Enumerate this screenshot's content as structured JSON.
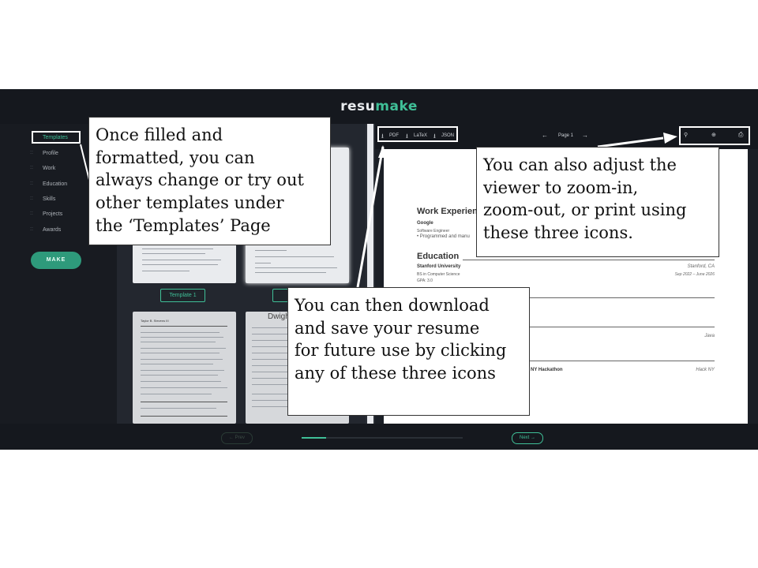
{
  "app": {
    "logo_a": "resu",
    "logo_b": "make"
  },
  "sidebar": {
    "items": [
      {
        "label": "Templates"
      },
      {
        "label": "Profile"
      },
      {
        "label": "Work"
      },
      {
        "label": "Education"
      },
      {
        "label": "Skills"
      },
      {
        "label": "Projects"
      },
      {
        "label": "Awards"
      }
    ],
    "make_label": "MAKE"
  },
  "gallery": {
    "template1_label": "Template 1",
    "template2_label": "Tem",
    "thumb3_heading": "Dwight",
    "thumb4_name": "Taylor B. Stevens III"
  },
  "viewer": {
    "pdf_label": "PDF",
    "latex_label": "LaTeX",
    "json_label": "JSON",
    "page_label": "Page 1",
    "prev_page_icon": "arrow-left-icon",
    "next_page_icon": "arrow-right-icon",
    "zoom_out_icon": "zoom-out-icon",
    "zoom_in_icon": "zoom-in-icon",
    "print_icon": "print-icon"
  },
  "resume": {
    "work_heading": "Work Experien",
    "company": "Google",
    "title": "Software Engineer",
    "bullet": "• Programmed and manu",
    "edu_heading": "Education",
    "school": "Stanford University",
    "school_location": "Stanford, CA",
    "degree": "BS in Computer Science",
    "dates": "Sep 2022 – June 2026",
    "gpa": "GPA: 3.0",
    "skill": "Java",
    "award": "NY Hackathon",
    "award_loc": "Hack NY"
  },
  "footer": {
    "prev_label": "← Prev",
    "next_label": "Next →",
    "progress": 0.15
  },
  "callouts": {
    "templates": "Once filled and\nformatted, you can\nalways change or try out\nother templates under\nthe ‘Templates’ Page",
    "zoom": "You can also adjust the\nviewer to zoom-in,\nzoom-out, or print using\nthese three icons.",
    "download": "You can then download\nand save your resume\nfor future use by clicking\nany of these three icons"
  },
  "colors": {
    "accent": "#3fbf97",
    "background": "#1b1f26"
  }
}
